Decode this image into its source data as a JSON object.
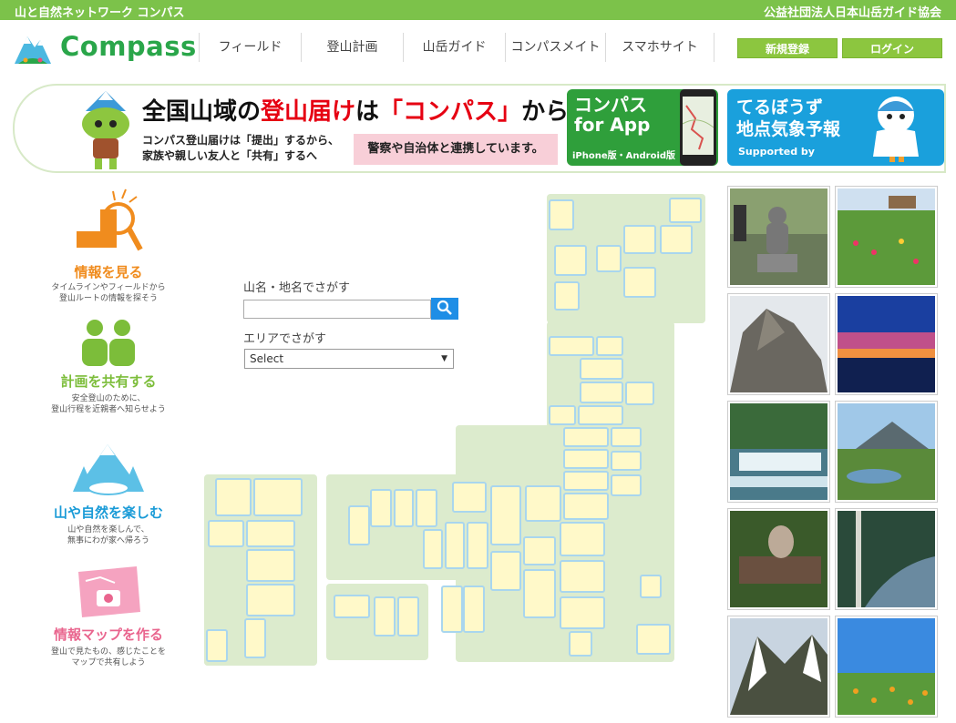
{
  "topbar": {
    "site_name": "山と自然ネットワーク コンパス",
    "org_name": "公益社団法人日本山岳ガイド協会"
  },
  "header": {
    "logo_text": "Compass",
    "nav": [
      "フィールド",
      "登山計画",
      "山岳ガイド",
      "コンパスメイト",
      "スマホサイト"
    ],
    "register_label": "新規登録",
    "login_label": "ログイン"
  },
  "banner": {
    "title_part1": "全国山域の",
    "title_red": "登山届け",
    "title_part2": "は",
    "title_quote": "「コンパス」",
    "title_part3": "から!",
    "sub_line1": "コンパス登山届けは「提出」するから、",
    "sub_line2": "家族や親しい友人と「共有」するへ",
    "pink_text": "警察や自治体と連携しています。",
    "app_line1": "コンパス",
    "app_line2": "for App",
    "app_sub": "iPhone版・Android版",
    "tel_line1": "てるぼうず",
    "tel_line2": "地点気象予報",
    "tel_sub": "Supported by"
  },
  "features": [
    {
      "title": "情報を見る",
      "desc1": "タイムラインやフィールドから",
      "desc2": "登山ルートの情報を探そう",
      "color": "#f08c1e"
    },
    {
      "title": "計画を共有する",
      "desc1": "安全登山のために、",
      "desc2": "登山行程を近親者へ知らせよう",
      "color": "#7cbd3a"
    },
    {
      "title": "山や自然を楽しむ",
      "desc1": "山や自然を楽しんで、",
      "desc2": "無事にわが家へ帰ろう",
      "color": "#1a9bd7"
    },
    {
      "title": "情報マップを作る",
      "desc1": "登山で見たもの、感じたことを",
      "desc2": "マップで共有しよう",
      "color": "#e9658e"
    }
  ],
  "search": {
    "name_label": "山名・地名でさがす",
    "name_value": "",
    "area_label": "エリアでさがす",
    "area_selected": "Select"
  },
  "colors": {
    "brand_green": "#7cc24a",
    "map_land": "#dcebcd",
    "pref_fill": "#fff9c9",
    "pref_border": "#a9d6ee",
    "search_blue": "#1e8ee6"
  },
  "photos": [
    {
      "icon": "buddha-statue-photo"
    },
    {
      "icon": "alpine-meadow-photo"
    },
    {
      "icon": "rocky-peak-photo"
    },
    {
      "icon": "sunset-sky-photo"
    },
    {
      "icon": "waterfall-photo"
    },
    {
      "icon": "marsh-mountain-photo"
    },
    {
      "icon": "animal-on-stump-photo"
    },
    {
      "icon": "stream-forest-photo"
    },
    {
      "icon": "snowy-ridge-photo"
    },
    {
      "icon": "flower-field-photo"
    }
  ]
}
